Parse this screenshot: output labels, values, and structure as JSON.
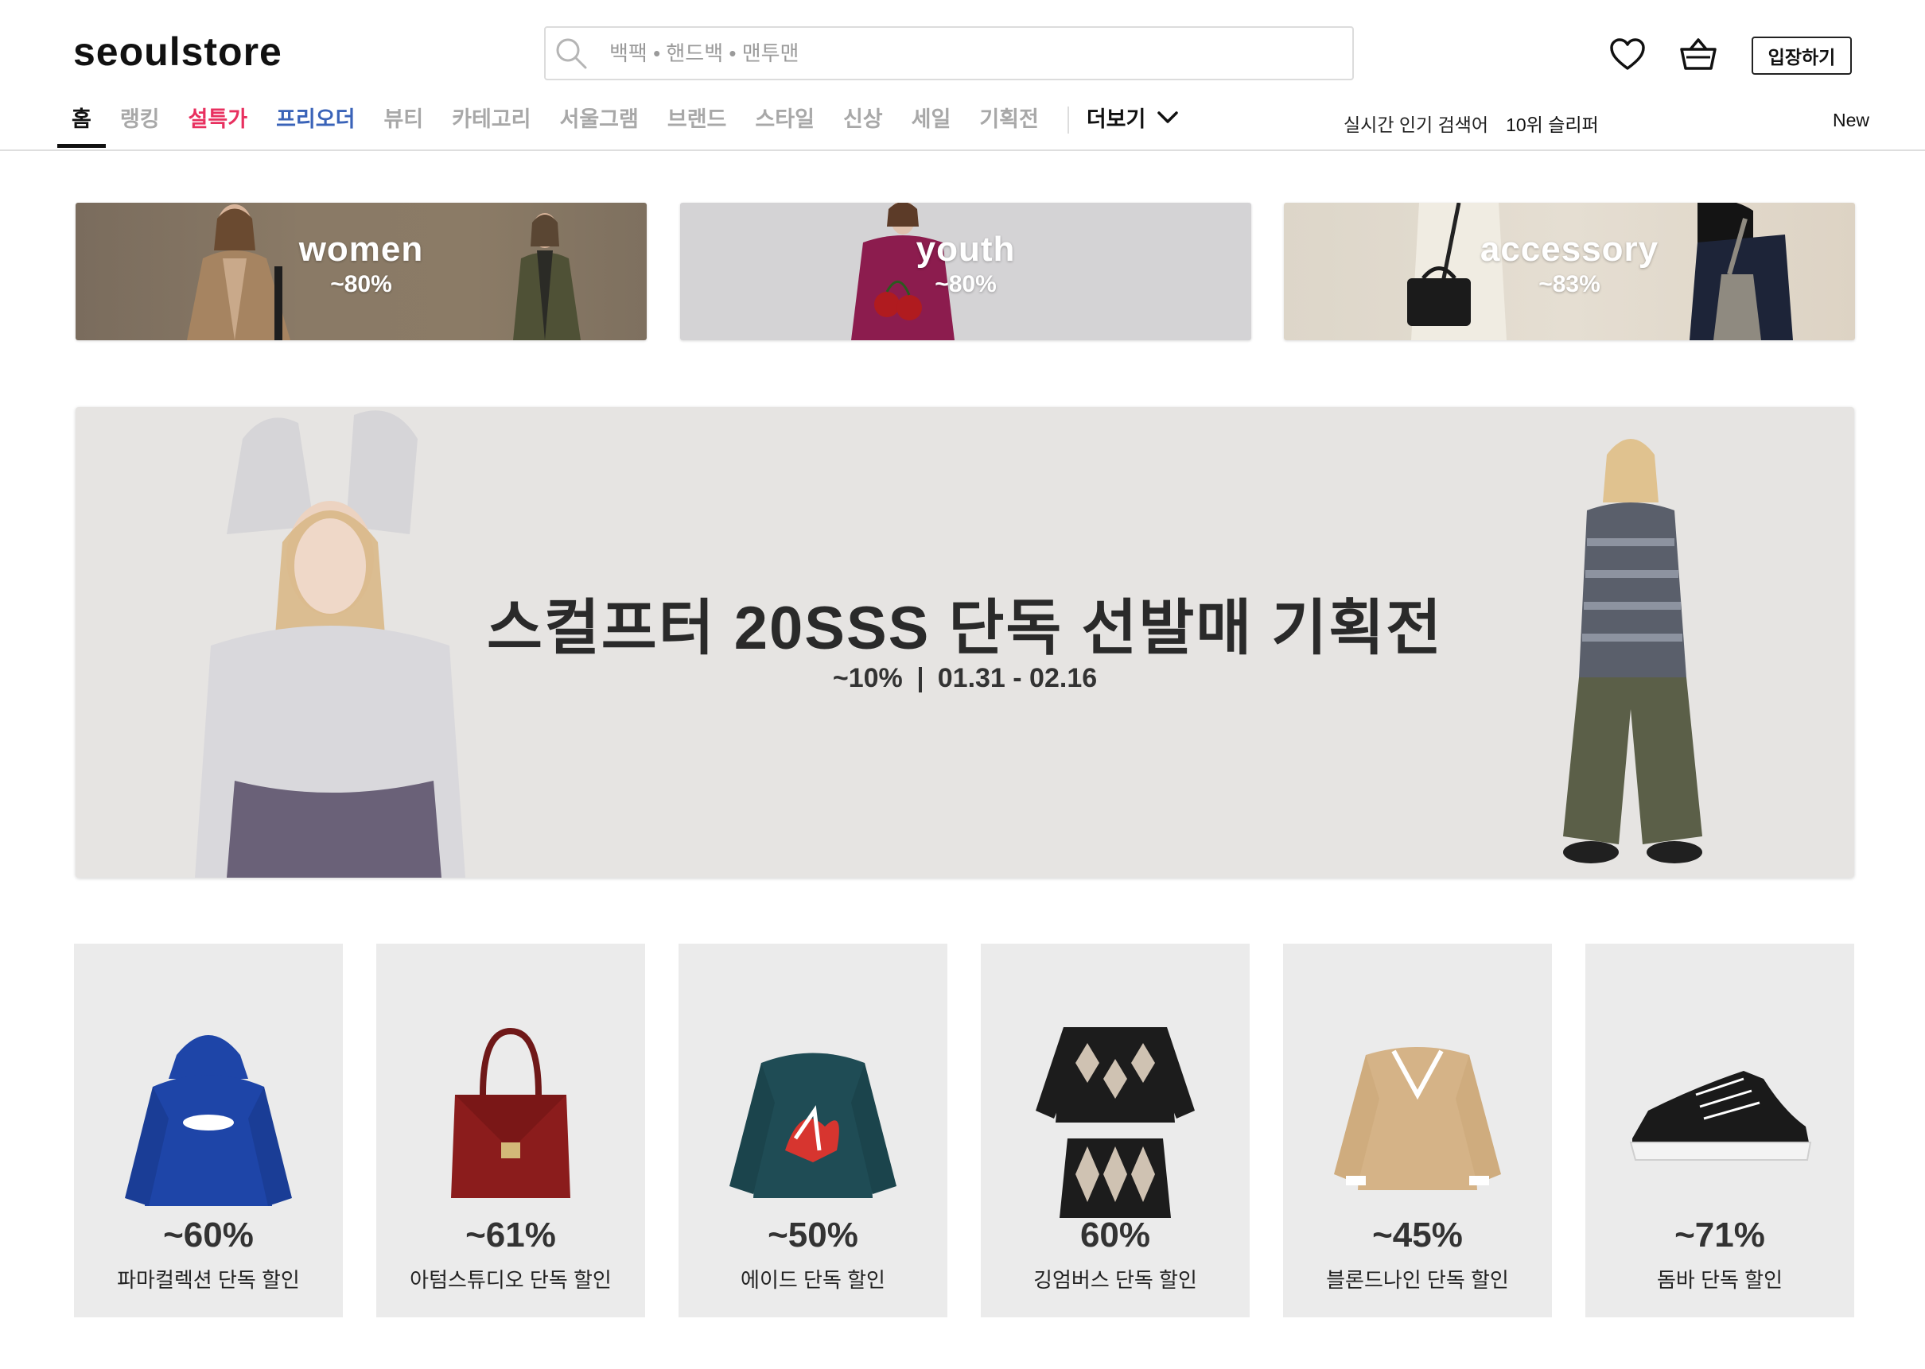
{
  "header": {
    "logo": "seoulstore",
    "search_placeholder": "백팩 • 핸드백 • 맨투맨",
    "login_label": "입장하기"
  },
  "nav": {
    "items": [
      {
        "label": "홈"
      },
      {
        "label": "랭킹"
      },
      {
        "label": "설특가"
      },
      {
        "label": "프리오더"
      },
      {
        "label": "뷰티"
      },
      {
        "label": "카테고리"
      },
      {
        "label": "서울그램"
      },
      {
        "label": "브랜드"
      },
      {
        "label": "스타일"
      },
      {
        "label": "신상"
      },
      {
        "label": "세일"
      },
      {
        "label": "기획전"
      }
    ],
    "more_label": "더보기",
    "trending_label": "실시간 인기 검색어",
    "trending_item": "10위 슬리퍼",
    "new_label": "New"
  },
  "categories": [
    {
      "title": "women",
      "discount": "~80%"
    },
    {
      "title": "youth",
      "discount": "~80%"
    },
    {
      "title": "accessory",
      "discount": "~83%"
    }
  ],
  "hero": {
    "title": "스컬프터 20SSS 단독 선발매 기획전",
    "discount": "~10%",
    "dates": "01.31 - 02.16"
  },
  "deals": [
    {
      "discount": "~60%",
      "label": "파마컬렉션 단독 할인"
    },
    {
      "discount": "~61%",
      "label": "아텀스튜디오 단독 할인"
    },
    {
      "discount": "~50%",
      "label": "에이드 단독 할인"
    },
    {
      "discount": "60%",
      "label": "깅엄버스 단독 할인"
    },
    {
      "discount": "~45%",
      "label": "블론드나인 단독 할인"
    },
    {
      "discount": "~71%",
      "label": "돔바 단독 할인"
    }
  ],
  "colors": {
    "accent_pink": "#e8305f",
    "accent_blue": "#3a63b8",
    "text": "#111111",
    "muted": "#a8a8a8"
  }
}
